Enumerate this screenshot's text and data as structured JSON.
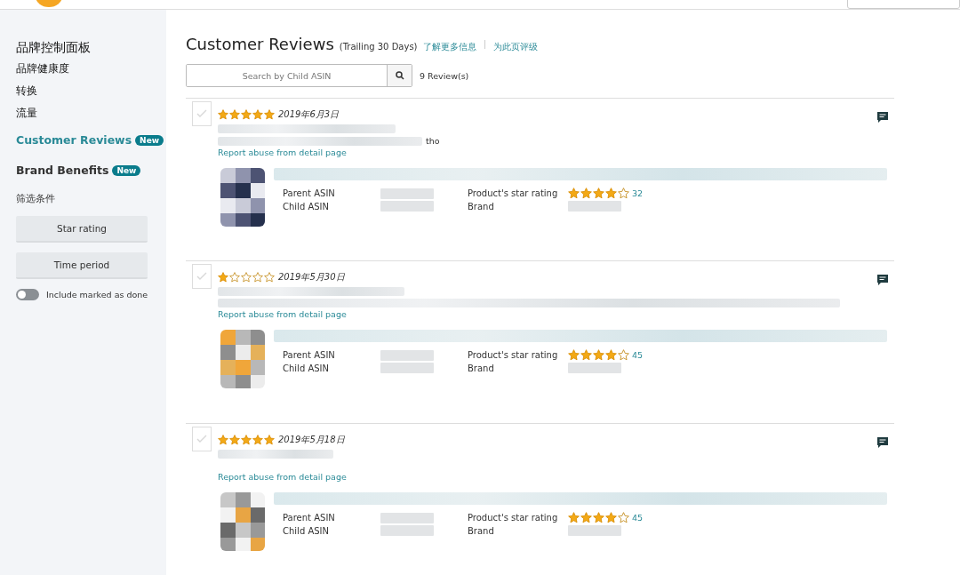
{
  "sidebar": {
    "items": [
      {
        "label": "品牌控制面板",
        "kind": "heading"
      },
      {
        "label": "品牌健康度",
        "kind": "link"
      },
      {
        "label": "转换",
        "kind": "link"
      },
      {
        "label": "流量",
        "kind": "link"
      },
      {
        "label": "Customer Reviews",
        "kind": "feature",
        "badge": "New",
        "selected": true
      },
      {
        "label": "Brand Benefits",
        "kind": "feature",
        "badge": "New",
        "selected": false
      }
    ],
    "filter_label": "筛选条件",
    "filter_buttons": [
      "Star rating",
      "Time period"
    ],
    "toggle": {
      "label": "Include marked as done",
      "on": false
    }
  },
  "header": {
    "title": "Customer Reviews",
    "subtitle": "(Trailing 30 Days)",
    "links": [
      "了解更多信息",
      "为此页评级"
    ]
  },
  "search": {
    "placeholder": "Search by Child ASIN"
  },
  "review_count": "9 Review(s)",
  "reviews": [
    {
      "checked": false,
      "stars": 5,
      "date": "2019年6月3日",
      "body_end": "tho",
      "report_link": "Report abuse from detail page",
      "product": {
        "parent_label": "Parent ASIN",
        "child_label": "Child ASIN",
        "rating_label": "Product's star rating",
        "rating": {
          "stars": 4
        },
        "rating_count": "32",
        "brand_label": "Brand"
      }
    },
    {
      "checked": false,
      "stars": 1,
      "date": "2019年5月30日",
      "report_link": "Report abuse from detail page",
      "product": {
        "parent_label": "Parent ASIN",
        "child_label": "Child ASIN",
        "rating_label": "Product's star rating",
        "rating": {
          "stars": 4
        },
        "rating_count": "45",
        "brand_label": "Brand"
      }
    },
    {
      "checked": false,
      "stars": 5,
      "date": "2019年5月18日",
      "report_link": "Report abuse from detail page",
      "product": {
        "parent_label": "Parent ASIN",
        "child_label": "Child ASIN",
        "rating_label": "Product's star rating",
        "rating": {
          "stars": 4
        },
        "rating_count": "45",
        "brand_label": "Brand"
      }
    }
  ]
}
